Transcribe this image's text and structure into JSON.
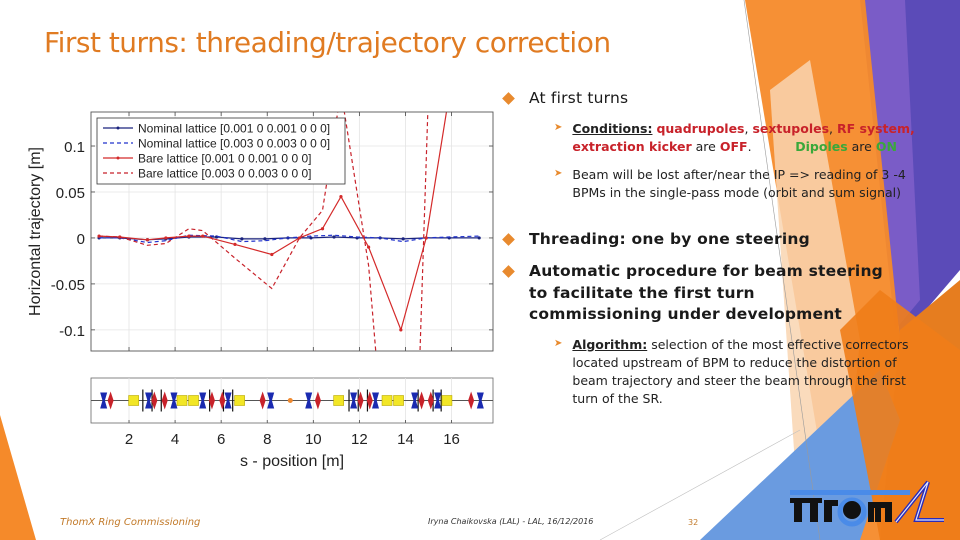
{
  "slide": {
    "title": "First turns: threading/trajectory correction",
    "page_number": "32",
    "footer_left": "ThomX Ring Commissioning",
    "footer_center": "Iryna Chaikovska (LAL) - LAL, 16/12/2016",
    "logo_text": "ThomX"
  },
  "theme": {
    "title_color": "#e07b22",
    "accent_orange": "#f58a2a",
    "accent_purple": "#5b4bb8",
    "accent_blue": "#6a9be0",
    "bullet_color": "#e88a2e",
    "off_color": "#c8222a",
    "on_color": "#3aa83a"
  },
  "bullets": [
    {
      "text": "At first turns",
      "sub": [
        {
          "label": "Conditions:",
          "red_items": [
            "quadrupoles",
            "sextupoles",
            "RF system,",
            "extraction kicker"
          ],
          "sep": ", ",
          "are_word": "are",
          "off_word": "OFF",
          "green_item": "Dipoles",
          "on_word": "ON"
        },
        {
          "text": "Beam will be lost after/near the IP => reading of 3 -4 BPMs in the single-pass mode (orbit and sum signal)"
        }
      ]
    },
    {
      "text": "Threading: one by one steering"
    },
    {
      "text": "Automatic procedure for beam steering to facilitate the first turn commissioning under development",
      "sub": [
        {
          "label": "Algorithm:",
          "text": " selection of the most effective correctors located upstream of BPM to reduce the distortion of beam trajectory and steer the beam through the first turn of the SR."
        }
      ]
    }
  ],
  "chart_data": [
    {
      "type": "line",
      "title": "",
      "xlabel": "",
      "ylabel": "Horizontal trajectory [m]",
      "xlim": [
        0.35,
        17.8
      ],
      "ylim": [
        -0.123,
        0.137
      ],
      "yticks": [
        0.1,
        0.05,
        0,
        -0.05,
        -0.1
      ],
      "ytick_labels": [
        "0.1",
        "0.05",
        "0",
        "-0.05",
        "-0.1"
      ],
      "xticks": [
        2,
        4,
        6,
        8,
        10,
        12,
        14,
        16
      ],
      "grid": true,
      "legend": "top-left",
      "series": [
        {
          "name": "Nominal lattice [0.001 0 0.001 0 0 0]",
          "color": "#1a237e",
          "style": "solid-marker",
          "x": [
            0.7,
            1.6,
            2.8,
            3.6,
            4.6,
            5.8,
            6.9,
            7.9,
            8.9,
            9.9,
            10.9,
            11.9,
            12.9,
            13.9,
            14.9,
            15.9,
            17.2
          ],
          "y": [
            0.0,
            0.0,
            -0.002,
            -0.001,
            0.001,
            0.001,
            -0.001,
            -0.001,
            0.0,
            0.0,
            0.001,
            0.0,
            0.0,
            -0.001,
            0.0,
            0.0,
            0.0
          ]
        },
        {
          "name": "Nominal lattice [0.003 0 0.003 0 0 0]",
          "color": "#2233cc",
          "style": "dashed",
          "x": [
            0.7,
            1.6,
            2.8,
            3.6,
            4.6,
            5.8,
            6.9,
            7.9,
            8.9,
            9.9,
            10.9,
            11.9,
            12.9,
            13.9,
            14.9,
            15.9,
            17.2
          ],
          "y": [
            0.0,
            0.0,
            -0.005,
            -0.003,
            0.003,
            0.002,
            -0.004,
            -0.003,
            0.0,
            0.002,
            0.003,
            0.001,
            0.0,
            -0.004,
            0.0,
            0.001,
            0.002
          ]
        },
        {
          "name": "Bare lattice [0.001 0 0.001 0 0 0]",
          "color": "#d42a2a",
          "style": "solid-marker",
          "x": [
            0.7,
            1.6,
            2.8,
            3.6,
            4.6,
            5.2,
            6.6,
            8.2,
            9.4,
            10.4,
            11.2,
            12.4,
            13.8,
            14.9,
            15.8
          ],
          "y": [
            0.002,
            0.001,
            -0.002,
            0.0,
            0.002,
            0.002,
            -0.007,
            -0.018,
            0.0,
            0.01,
            0.045,
            -0.01,
            -0.1,
            0.0,
            0.14
          ]
        },
        {
          "name": "Bare lattice [0.003 0 0.003 0 0 0]",
          "color": "#c8222a",
          "style": "dashed",
          "x": [
            0.7,
            1.6,
            2.8,
            3.6,
            4.6,
            5.2,
            6.6,
            8.2,
            9.4,
            10.4,
            11.2,
            12.4,
            13.3,
            14.4,
            15.0
          ],
          "y": [
            0.002,
            0.001,
            -0.008,
            -0.006,
            0.01,
            0.008,
            -0.022,
            -0.055,
            0.0,
            0.03,
            0.16,
            -0.03,
            -0.3,
            -0.3,
            0.16
          ]
        }
      ]
    },
    {
      "type": "scatter",
      "title": "",
      "xlabel": "s - position [m]",
      "xlim": [
        0.35,
        17.8
      ],
      "xticks": [
        2,
        4,
        6,
        8,
        10,
        12,
        14,
        16
      ],
      "xtick_labels": [
        "2",
        "4",
        "6",
        "8",
        "10",
        "12",
        "14",
        "16"
      ],
      "description": "lattice layout",
      "elements": {
        "focusing_quad_blue": [
          0.9,
          2.85,
          3.95,
          5.2,
          6.3,
          8.15,
          9.8,
          11.75,
          12.7,
          14.4,
          15.4,
          17.25
        ],
        "defocusing_quad_red": [
          1.2,
          3.1,
          3.55,
          5.6,
          6.05,
          7.8,
          10.2,
          12.05,
          12.45,
          14.7,
          15.1,
          16.85
        ],
        "dipole_yellow": [
          2.2,
          4.3,
          4.8,
          6.8,
          11.1,
          13.2,
          13.7,
          15.8
        ],
        "bpm_black_lines": [
          2.6,
          3.0,
          3.4,
          5.5,
          6.1,
          6.5,
          11.55,
          11.95,
          12.35,
          14.55,
          15.2,
          15.55
        ],
        "ip_orange": [
          9.0
        ]
      },
      "legend": "none"
    }
  ]
}
